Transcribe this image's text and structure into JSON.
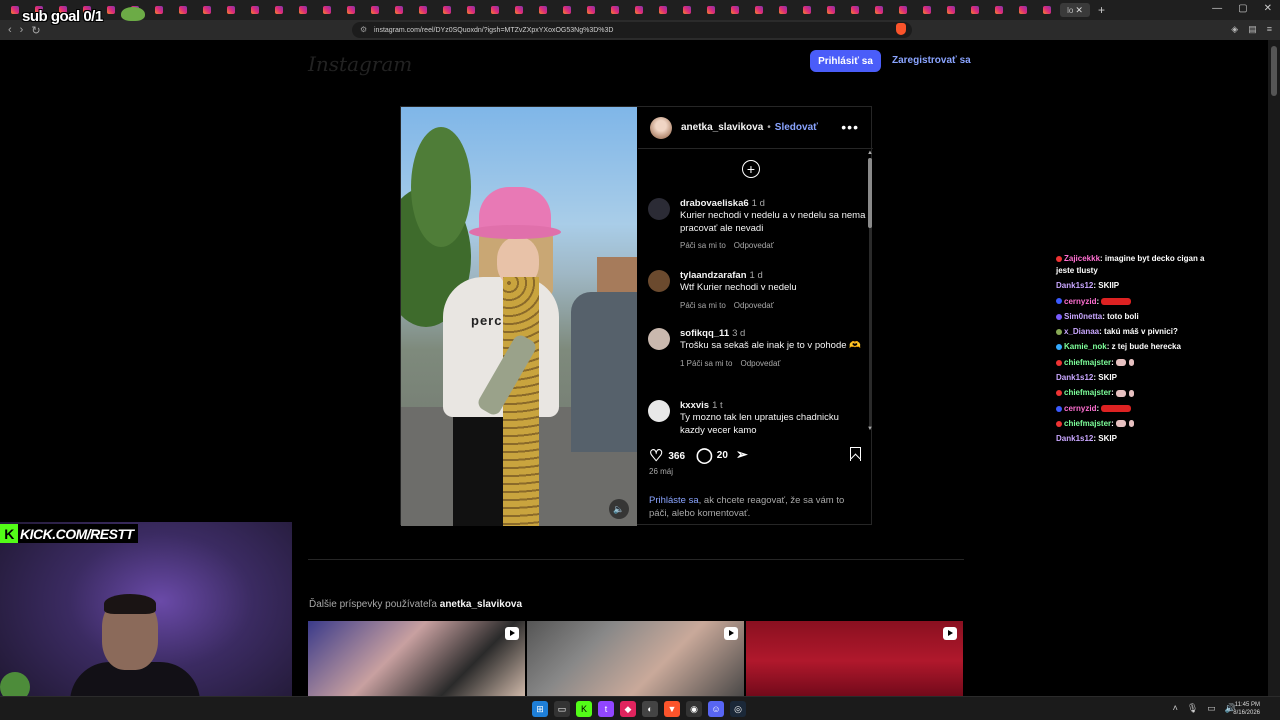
{
  "browser": {
    "url": "instagram.com/reel/DYz0SQuoxdn/?igsh=MTZvZXpxYXoxOG53Ng%3D%3D",
    "tabs_count": 44,
    "active_tab_label": "lo"
  },
  "instagram": {
    "logo": "Instagram",
    "login_label": "Prihlásiť sa",
    "register_label": "Zaregistrovať sa",
    "post": {
      "username": "anetka_slavikova",
      "separator": "•",
      "follow_label": "Sledovať",
      "shirt_text": "perche",
      "comments": [
        {
          "user": "drabovaeliska6",
          "time": "1 d",
          "text": "Kurier nechodi v nedelu a v nedelu sa nema pracovať ale nevadi",
          "likes_label": "Páči sa mi to",
          "reply_label": "Odpovedať",
          "avatar_color": "#2b2b35"
        },
        {
          "user": "tylaandzarafan",
          "time": "1 d",
          "text": "Wtf Kurier nechodi v nedelu",
          "likes_label": "Páči sa mi to",
          "reply_label": "Odpovedať",
          "avatar_color": "#6b4a2e"
        },
        {
          "user": "sofikqq_11",
          "time": "3 d",
          "text": "Trošku sa sekaš ale inak je to v pohode 🫶",
          "likes_label": "1 Páči sa mi to",
          "reply_label": "Odpovedať",
          "avatar_color": "#c9b8ae"
        },
        {
          "user": "kxxvis",
          "time": "1 t",
          "text": "Ty mozno tak len upratujes chadnicku kazdy vecer kamo",
          "likes_label": "",
          "reply_label": "",
          "avatar_color": "#e8e8e8"
        }
      ],
      "likes": "366",
      "comments_count": "20",
      "date": "26 máj",
      "login_prompt_link": "Prihláste sa",
      "login_prompt_text": ", ak chcete reagovať, že sa vám to páči, alebo komentovať."
    },
    "more_posts_prefix": "Ďalšie príspevky používateľa",
    "more_posts_user": "anetka_slavikova"
  },
  "stream": {
    "sub_goal": "sub goal 0/1",
    "kick_url": "KICK.COM/RESTT",
    "chat": [
      {
        "user": "Zajicekkk",
        "user_color": "#ff6fd1",
        "badge_color": "#e33",
        "text": "imagine byt decko cigan a jeste tlusty",
        "emote": ""
      },
      {
        "user": "Dank1s12",
        "user_color": "#c9a7ff",
        "badge_color": "",
        "text": "SKIIP",
        "emote": ""
      },
      {
        "user": "cernyzid",
        "user_color": "#ff6fd1",
        "badge_color": "#3b5bff",
        "text": "",
        "emote": "car"
      },
      {
        "user": "Sim0netta",
        "user_color": "#c9a7ff",
        "badge_color": "#7a5cff",
        "text": "toto boli",
        "emote": ""
      },
      {
        "user": "x_Dianaa",
        "user_color": "#c9a7ff",
        "badge_color": "#88aa55",
        "text": "takú máš v pivnici?",
        "emote": ""
      },
      {
        "user": "Kamie_nok",
        "user_color": "#7dff9a",
        "badge_color": "#33aaff",
        "text": "z tej bude herecka",
        "emote": ""
      },
      {
        "user": "chiefmajster",
        "user_color": "#7dff9a",
        "badge_color": "#e33",
        "text": "",
        "emote": "small"
      },
      {
        "user": "Dank1s12",
        "user_color": "#c9a7ff",
        "badge_color": "",
        "text": "SKIP",
        "emote": ""
      },
      {
        "user": "chiefmajster",
        "user_color": "#7dff9a",
        "badge_color": "#e33",
        "text": "",
        "emote": "small"
      },
      {
        "user": "cernyzid",
        "user_color": "#ff6fd1",
        "badge_color": "#3b5bff",
        "text": "",
        "emote": "car"
      },
      {
        "user": "chiefmajster",
        "user_color": "#7dff9a",
        "badge_color": "#e33",
        "text": "",
        "emote": "small"
      },
      {
        "user": "Dank1s12",
        "user_color": "#c9a7ff",
        "badge_color": "",
        "text": "SKIP",
        "emote": ""
      }
    ]
  },
  "taskbar": {
    "time": "11:45 PM",
    "date": "8/16/2026"
  }
}
